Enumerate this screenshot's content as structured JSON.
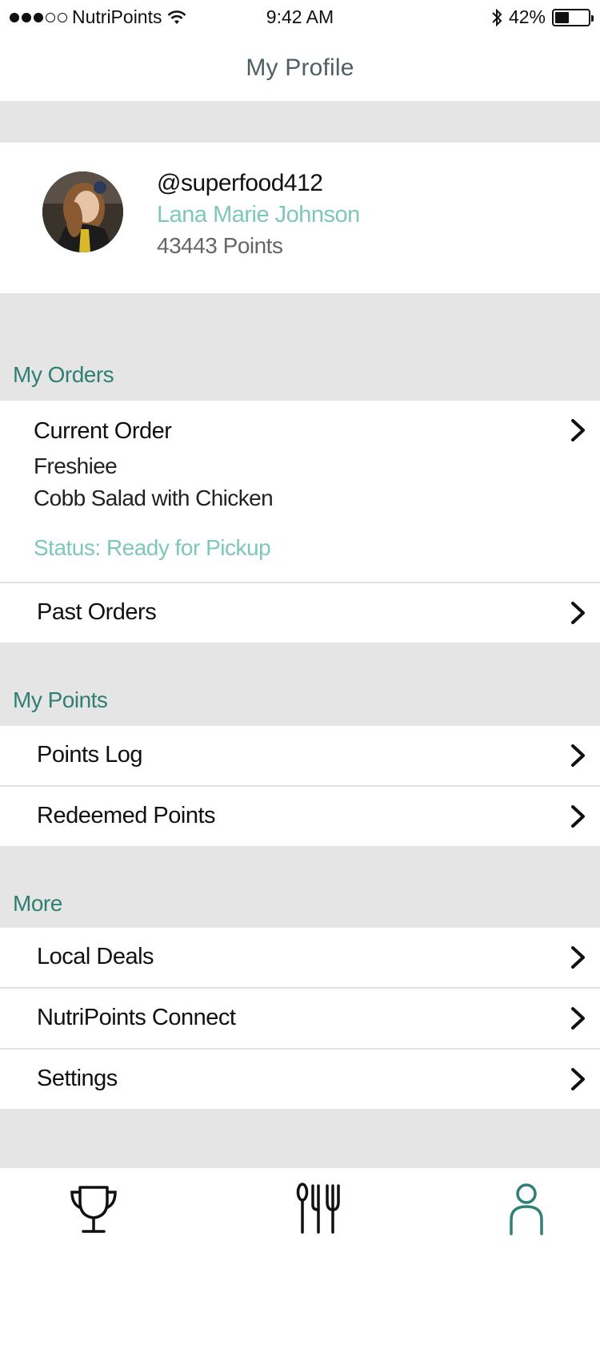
{
  "status_bar": {
    "carrier": "NutriPoints",
    "time": "9:42 AM",
    "battery_percent": "42%",
    "battery_level": 0.42,
    "signal_bars": 3,
    "signal_total": 5
  },
  "header": {
    "title": "My Profile"
  },
  "profile": {
    "handle": "@superfood412",
    "name": "Lana Marie Johnson",
    "points": "43443 Points"
  },
  "sections": {
    "orders": {
      "heading": "My Orders",
      "current_order": {
        "title": "Current Order",
        "restaurant": "Freshiee",
        "item": "Cobb Salad with Chicken",
        "status": "Status: Ready for Pickup"
      },
      "past_orders": "Past Orders"
    },
    "points": {
      "heading": "My Points",
      "log": "Points Log",
      "redeemed": "Redeemed Points"
    },
    "more": {
      "heading": "More",
      "local_deals": "Local Deals",
      "connect": "NutriPoints Connect",
      "settings": "Settings"
    }
  },
  "tab_bar": {
    "tabs": [
      {
        "icon": "trophy-icon",
        "active": false
      },
      {
        "icon": "utensils-icon",
        "active": false
      },
      {
        "icon": "profile-icon",
        "active": true
      }
    ]
  },
  "colors": {
    "accent": "#2e7f74",
    "accent_light": "#7dc8b8",
    "band": "#e5e5e5"
  }
}
